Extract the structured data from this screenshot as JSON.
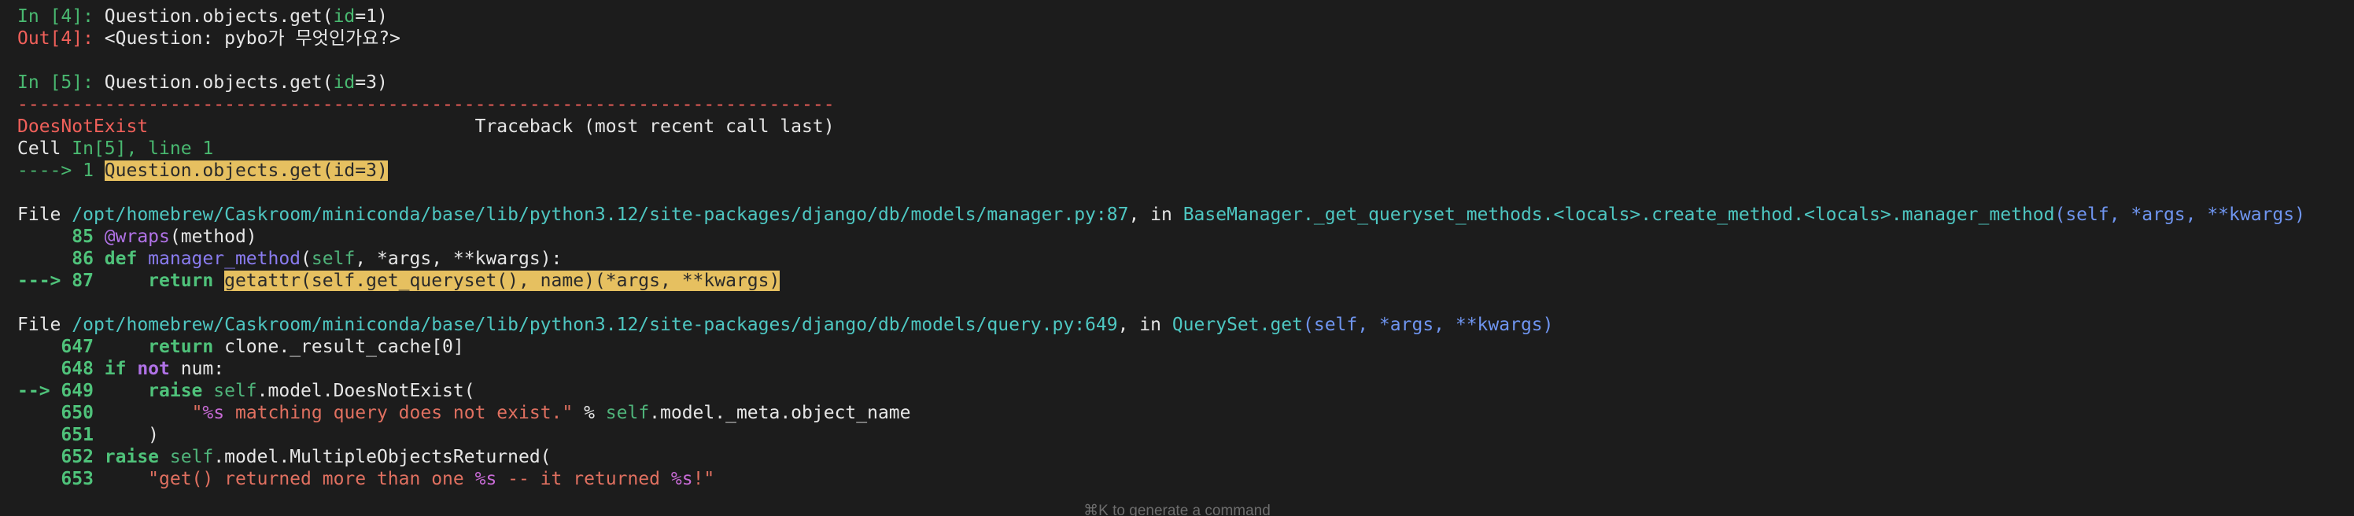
{
  "cells": {
    "in4_prompt": "In [4]: ",
    "in4_code_a": "Question.objects.get(",
    "in4_code_kw": "id",
    "in4_code_b": "=1)",
    "out4_prompt": "Out[4]: ",
    "out4_value": "<Question: pybo가 무엇인가요?>",
    "in5_prompt": "In [5]: ",
    "in5_code_a": "Question.objects.get(",
    "in5_code_kw": "id",
    "in5_code_b": "=3)"
  },
  "traceback": {
    "separator": "---------------------------------------------------------------------------",
    "exception_name": "DoesNotExist",
    "header_spacer": "                              ",
    "header_label": "Traceback (most recent call last)",
    "cell_label": "Cell ",
    "cell_ref": "In[5], line 1",
    "arrow_line": "----> 1 ",
    "arrow_code": "Question.objects.get(id=3)",
    "frames": [
      {
        "file_label": "File ",
        "path": "/opt/homebrew/Caskroom/miniconda/base/lib/python3.12/site-packages/django/db/models/manager.py:87",
        "in_label": ", in ",
        "func": "BaseManager._get_queryset_methods.<locals>.create_method.<locals>.manager_method",
        "sig": "(self, *args, **kwargs)"
      },
      {
        "file_label": "File ",
        "path": "/opt/homebrew/Caskroom/miniconda/base/lib/python3.12/site-packages/django/db/models/query.py:649",
        "in_label": ", in ",
        "func": "QuerySet.get",
        "sig": "(self, *args, **kwargs)"
      }
    ],
    "manager_lines": {
      "l85_no": "     85 ",
      "l85_deco": "@wraps",
      "l85_rest": "(method)",
      "l86_no": "     86 ",
      "l86_kw": "def ",
      "l86_fn": "manager_method",
      "l86_p1": "(",
      "l86_self": "self",
      "l86_p2": ", *args, **kwargs):",
      "l87_arrow": "---> 87 ",
      "l87_kw": "    return ",
      "l87_hl": "getattr(self.get_queryset(), name)(*args, **kwargs)"
    },
    "query_lines": {
      "l647_no": "    647 ",
      "l647_kw": "    return ",
      "l647_rest": "clone._result_cache[0]",
      "l648_no": "    648 ",
      "l648_kw1": "if ",
      "l648_kw2": "not ",
      "l648_rest": "num:",
      "l649_arrow": "--> 649 ",
      "l649_kw": "    raise ",
      "l649_self": "self",
      "l649_rest": ".model.DoesNotExist(",
      "l650_no": "    650 ",
      "l650_indent": "        ",
      "l650_str1": "\"",
      "l650_fmt": "%s",
      "l650_str2": " matching query does not exist.\"",
      "l650_op": " % ",
      "l650_self": "self",
      "l650_rest": ".model._meta.object_name",
      "l651_no": "    651 ",
      "l651_rest": "    )",
      "l652_no": "    652 ",
      "l652_kw": "raise ",
      "l652_self": "self",
      "l652_rest": ".model.MultipleObjectsReturned(",
      "l653_no": "    653 ",
      "l653_indent": "    ",
      "l653_str1": "\"get() returned more than one ",
      "l653_fmt1": "%s",
      "l653_str2": " -- it returned ",
      "l653_fmt2": "%s",
      "l653_str3": "!\""
    }
  },
  "hint": "⌘K to generate a command",
  "colors": {
    "background": "#1c1c1c",
    "prompt_in": "#49b870",
    "prompt_out": "#f0605a",
    "highlight": "#e6c060",
    "path": "#4ec7c2",
    "signature": "#6f95f0"
  }
}
